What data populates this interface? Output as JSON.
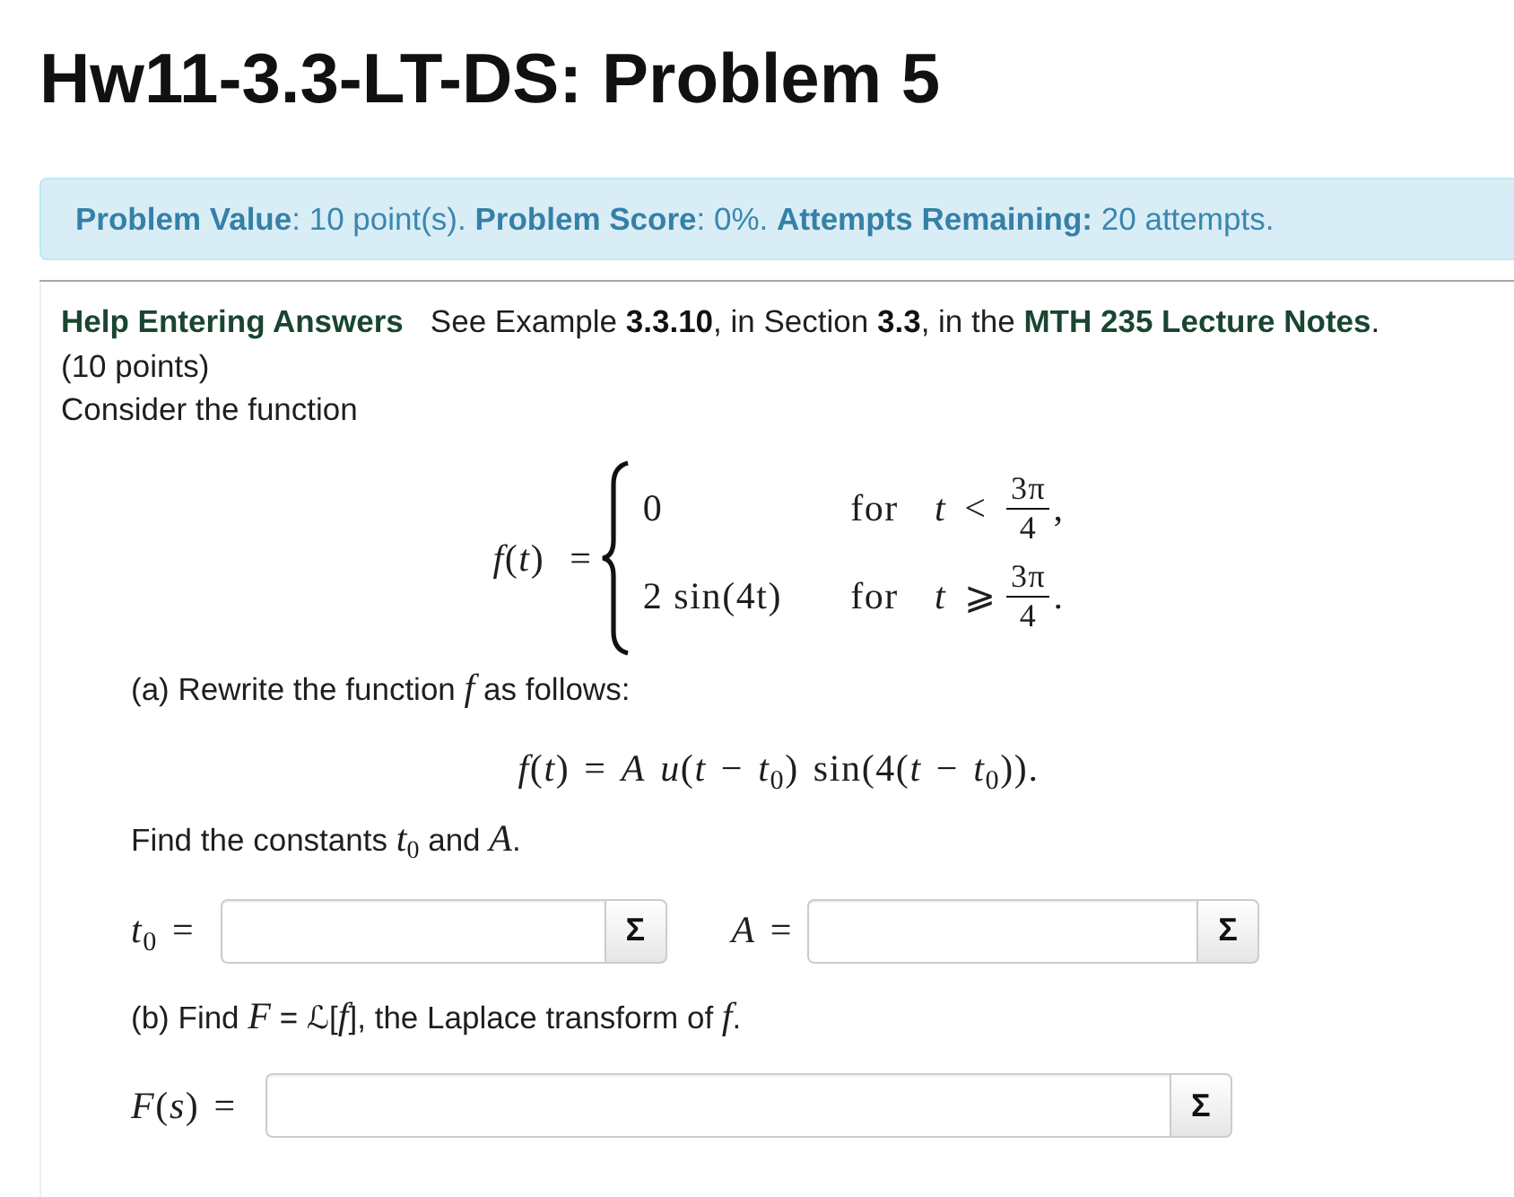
{
  "title": "Hw11-3.3-LT-DS: Problem 5",
  "status": "**Problem Value**: 10 point(s). **Problem Score**: 0%. **Attempts Remaining:** 20 attempts.",
  "help": {
    "link": "Help Entering Answers",
    "text": "See Example **3.3.10**, in Section **3.3**, in the ",
    "notes_link": "MTH 235 Lecture Notes",
    "end": "."
  },
  "points": "(10 points)",
  "intro": "Consider the function",
  "piecewise": {
    "lhs": "*f*(*t*) =",
    "cases": [
      {
        "expr": "0",
        "word": "for",
        "relation": "*t* <",
        "numerator": "3π",
        "denominator": "4",
        "punct": ","
      },
      {
        "expr": "2 sin(4t)",
        "word": "for",
        "relation": "*t* ⩾",
        "numerator": "3π",
        "denominator": "4",
        "punct": "."
      }
    ]
  },
  "part_a": {
    "prompt": "(a) Rewrite the function *f* as follows:",
    "formula": "*f*(*t*) = *A* *u*(*t* − *t*$_{0}$) sin(4(*t* − *t*$_{0}$)).",
    "question": "Find the constants *t*$_{0}$ and *A*.",
    "answers": [
      {
        "label": "*t*$_{0}$ =",
        "button": "Σ"
      },
      {
        "label": "*A* =",
        "button": "Σ"
      }
    ]
  },
  "part_b": {
    "prompt": "(b) Find *F* = ℒ[*f*], the Laplace transform of *f*.",
    "answers": [
      {
        "label": "*F*(*s*) =",
        "button": "Σ"
      }
    ]
  }
}
